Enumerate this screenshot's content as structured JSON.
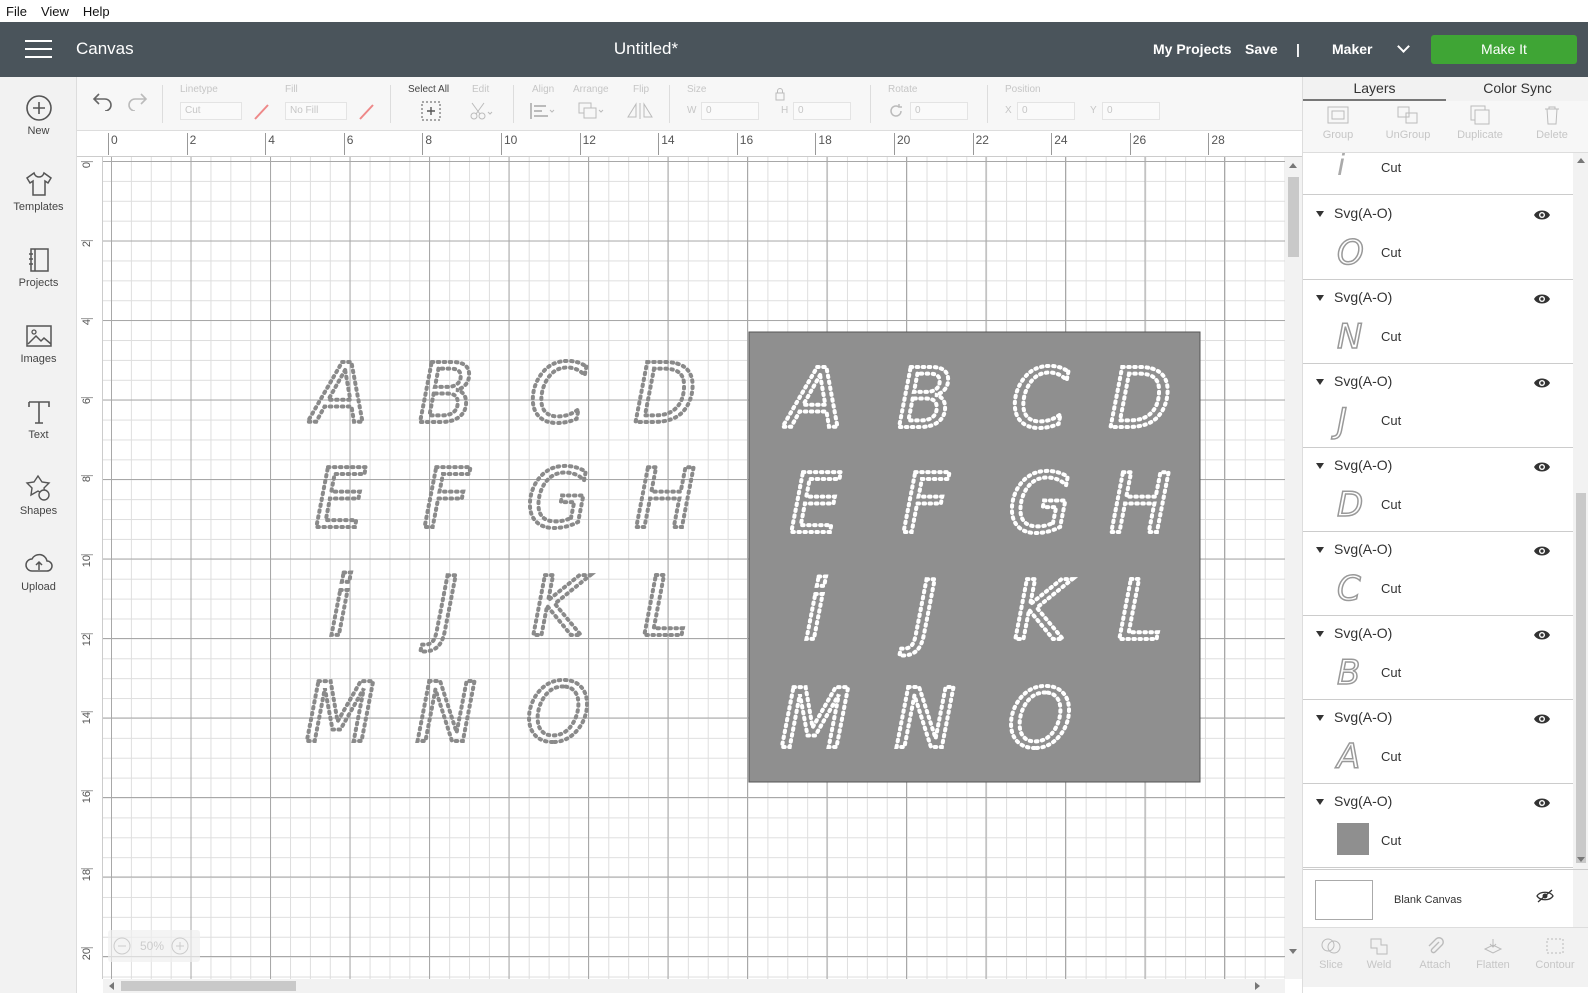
{
  "menubar": {
    "items": [
      "File",
      "View",
      "Help"
    ]
  },
  "header": {
    "app_title": "Canvas",
    "doc_title": "Untitled*",
    "my_projects": "My Projects",
    "save": "Save",
    "separator": "|",
    "machine": "Maker",
    "make_it": "Make It",
    "make_it_color": "#3fa535",
    "bar_color": "#4a545b"
  },
  "leftnav": {
    "items": [
      {
        "label": "New",
        "icon": "plus-circle-icon"
      },
      {
        "label": "Templates",
        "icon": "tshirt-icon"
      },
      {
        "label": "Projects",
        "icon": "book-icon"
      },
      {
        "label": "Images",
        "icon": "image-icon"
      },
      {
        "label": "Text",
        "icon": "text-T-icon"
      },
      {
        "label": "Shapes",
        "icon": "shapes-icon"
      },
      {
        "label": "Upload",
        "icon": "cloud-upload-icon"
      }
    ]
  },
  "toolbar": {
    "linetype_label": "Linetype",
    "linetype_value": "Cut",
    "fill_label": "Fill",
    "fill_value": "No Fill",
    "select_all_label": "Select All",
    "edit_label": "Edit",
    "align_label": "Align",
    "arrange_label": "Arrange",
    "flip_label": "Flip",
    "size_label": "Size",
    "w_label": "W",
    "w_value": "0",
    "h_label": "H",
    "h_value": "0",
    "rotate_label": "Rotate",
    "rotate_value": "0",
    "position_label": "Position",
    "x_label": "X",
    "x_value": "0",
    "y_label": "Y",
    "y_value": "0"
  },
  "rulers": {
    "top": [
      "0",
      "2",
      "4",
      "6",
      "8",
      "10",
      "12",
      "14",
      "16",
      "18",
      "20",
      "22",
      "24",
      "26",
      "28"
    ],
    "left": [
      "0",
      "2",
      "4",
      "6",
      "8",
      "10",
      "12",
      "14",
      "16",
      "18",
      "20"
    ]
  },
  "canvas": {
    "zoom": "50%",
    "left_letters": [
      [
        "A",
        "B",
        "C",
        "D"
      ],
      [
        "E",
        "F",
        "G",
        "H"
      ],
      [
        "i",
        "J",
        "K",
        "L"
      ],
      [
        "M",
        "N",
        "O"
      ]
    ],
    "right_letters": [
      [
        "A",
        "B",
        "C",
        "D"
      ],
      [
        "E",
        "F",
        "G",
        "H"
      ],
      [
        "i",
        "J",
        "K",
        "L"
      ],
      [
        "M",
        "N",
        "O"
      ]
    ],
    "panel_color": "#8f8f8f"
  },
  "right_panel": {
    "tabs": [
      "Layers",
      "Color Sync"
    ],
    "tools": [
      "Group",
      "UnGroup",
      "Duplicate",
      "Delete"
    ],
    "top_partial_layer": {
      "glyph": "i",
      "op": "Cut"
    },
    "layers": [
      {
        "name": "Svg(A-O)",
        "glyph": "O",
        "op": "Cut"
      },
      {
        "name": "Svg(A-O)",
        "glyph": "N",
        "op": "Cut"
      },
      {
        "name": "Svg(A-O)",
        "glyph": "J",
        "op": "Cut"
      },
      {
        "name": "Svg(A-O)",
        "glyph": "D",
        "op": "Cut"
      },
      {
        "name": "Svg(A-O)",
        "glyph": "C",
        "op": "Cut"
      },
      {
        "name": "Svg(A-O)",
        "glyph": "B",
        "op": "Cut"
      },
      {
        "name": "Svg(A-O)",
        "glyph": "A",
        "op": "Cut"
      },
      {
        "name": "Svg(A-O)",
        "glyph": "",
        "op": "Cut"
      }
    ],
    "blank_canvas": "Blank Canvas",
    "bottom_tools": [
      "Slice",
      "Weld",
      "Attach",
      "Flatten",
      "Contour"
    ]
  }
}
